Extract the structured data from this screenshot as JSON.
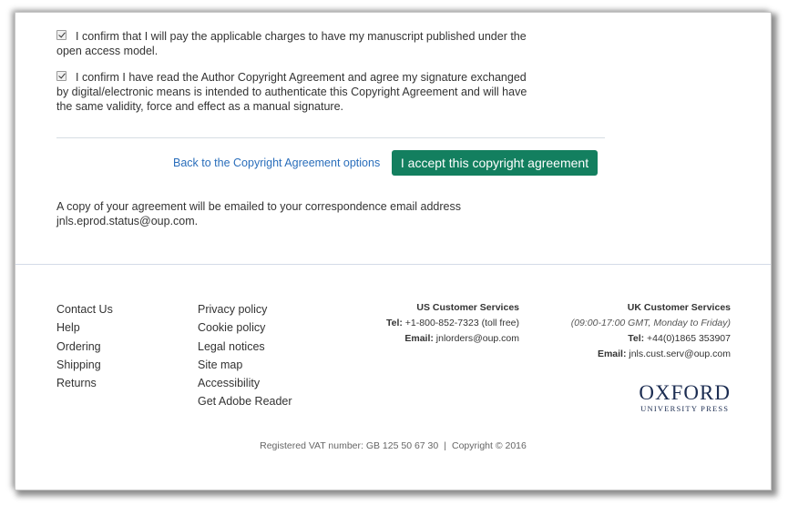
{
  "confirmations": [
    {
      "checked": true,
      "text": "I confirm that I will pay the applicable charges to have my manuscript published under the open access model."
    },
    {
      "checked": true,
      "text": "I confirm I have read the Author Copyright Agreement and agree my signature exchanged by digital/electronic means is intended to authenticate this Copyright Agreement and will have the same validity, force and effect as a manual signature."
    }
  ],
  "actions": {
    "back_link": "Back to the Copyright Agreement options",
    "accept_button": "I accept this copyright agreement",
    "accept_color": "#137f5f",
    "link_color": "#2a6ebb"
  },
  "email_note": "A copy of your agreement will be emailed to your correspondence email address jnls.eprod.status@oup.com.",
  "footer": {
    "links_col1": [
      "Contact Us",
      "Help",
      "Ordering",
      "Shipping",
      "Returns"
    ],
    "links_col2": [
      "Privacy policy",
      "Cookie policy",
      "Legal notices",
      "Site map",
      "Accessibility",
      "Get Adobe Reader"
    ],
    "us_services": {
      "title": "US Customer Services",
      "tel_label": "Tel:",
      "tel": "+1-800-852-7323 (toll free)",
      "email_label": "Email:",
      "email": "jnlorders@oup.com"
    },
    "uk_services": {
      "title": "UK Customer Services",
      "hours": "(09:00-17:00 GMT, Monday to Friday)",
      "tel_label": "Tel:",
      "tel": "+44(0)1865 353907",
      "email_label": "Email:",
      "email": "jnls.cust.serv@oup.com"
    },
    "logo": {
      "line1": "OXFORD",
      "line2": "UNIVERSITY PRESS"
    },
    "vat": "Registered VAT number: GB 125 50 67 30",
    "separator": "|",
    "copyright": "Copyright © 2016"
  }
}
